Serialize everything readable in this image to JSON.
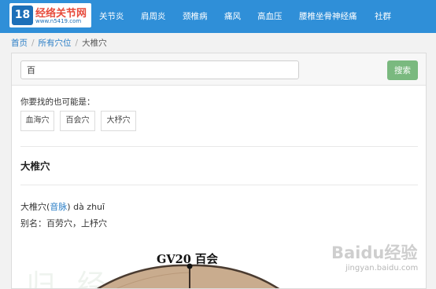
{
  "logo": {
    "badge_text": "18",
    "name": "经络关节网",
    "url": "www.n5419.com"
  },
  "nav": {
    "items": [
      "关节炎",
      "肩周炎",
      "颈椎病",
      "痛风",
      "高血压",
      "腰椎坐骨神经痛",
      "社群"
    ]
  },
  "breadcrumb": {
    "home": "首页",
    "all": "所有穴位",
    "separator": "/",
    "current": "大椎穴"
  },
  "search": {
    "value": "百",
    "button_label": "搜索"
  },
  "suggestions": {
    "label": "你要找的也可能是：",
    "items": [
      "血海穴",
      "百会穴",
      "大杼穴"
    ]
  },
  "article": {
    "title": "大椎穴",
    "pron_prefix": "大椎穴(",
    "pron_link": "音脉",
    "pron_suffix": ") dà zhuī",
    "alias": "别名：百劳穴，上杼穴"
  },
  "figure": {
    "label": "GV20 百会",
    "watermark": "归经关节"
  },
  "watermark": {
    "brand": "Baidu经验",
    "sub": "jingyan.baidu.com"
  },
  "colors": {
    "nav_bg": "#2f8fd8",
    "link": "#2a7ec6",
    "search_button": "#7ab97f"
  }
}
